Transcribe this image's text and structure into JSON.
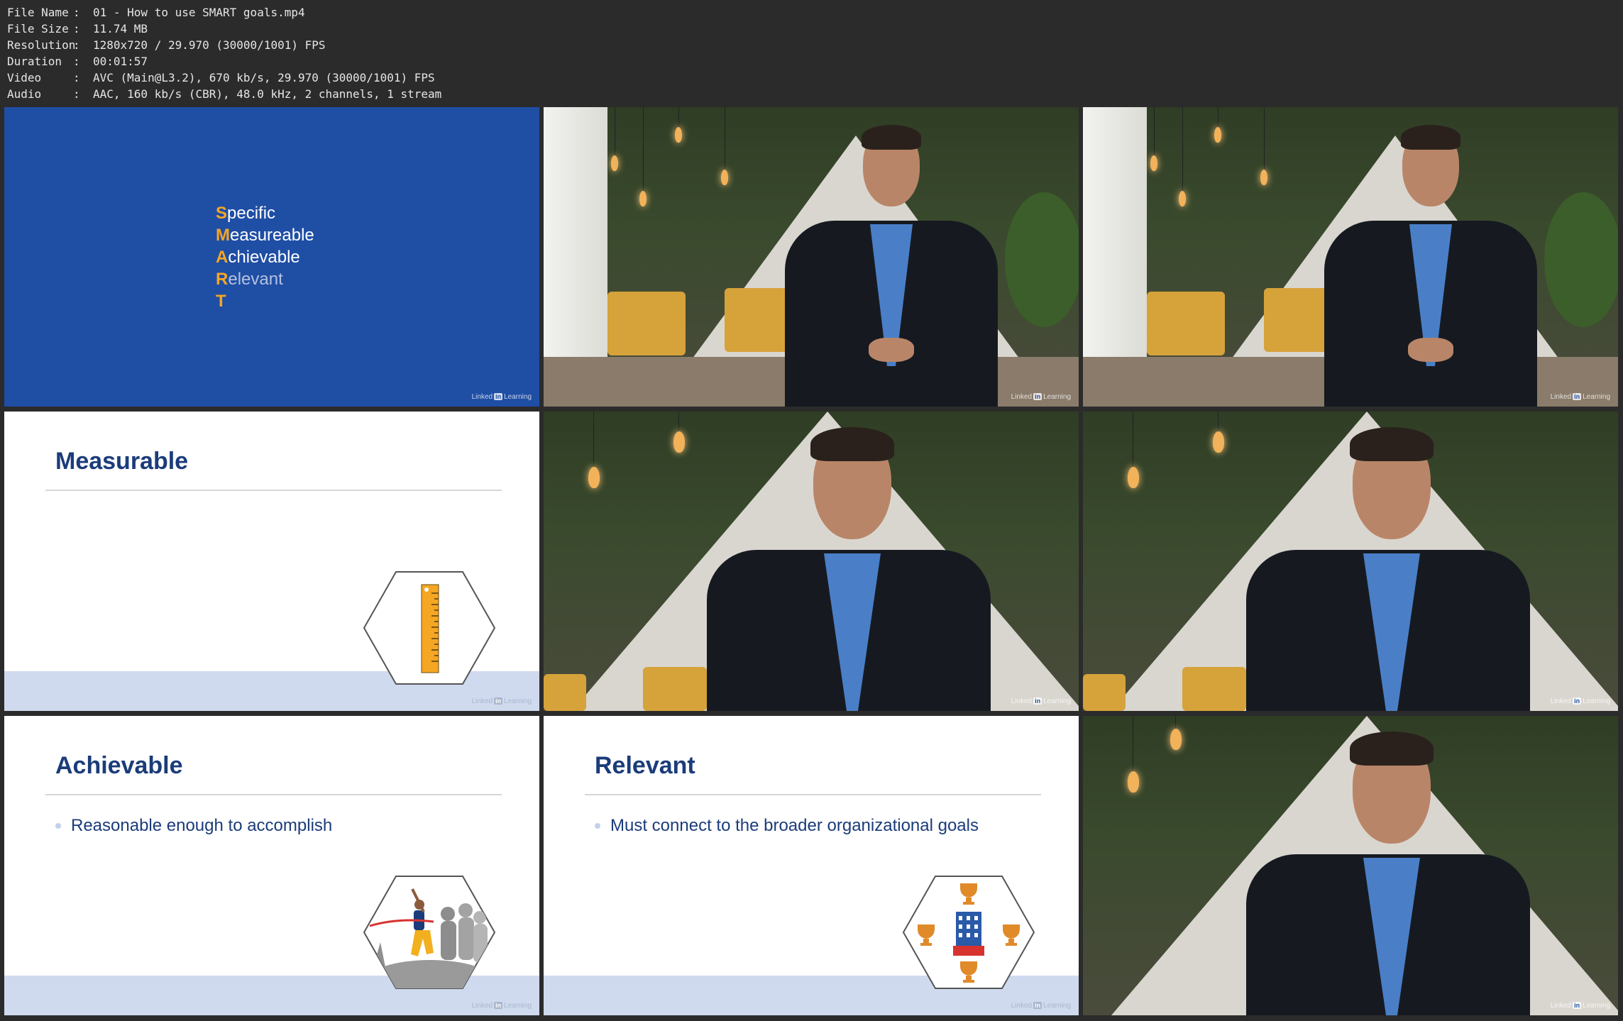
{
  "meta": [
    {
      "key": "File Name",
      "value": "01 - How to use SMART goals.mp4"
    },
    {
      "key": "File Size",
      "value": "11.74 MB"
    },
    {
      "key": "Resolution",
      "value": "1280x720 / 29.970 (30000/1001) FPS"
    },
    {
      "key": "Duration",
      "value": "00:01:57"
    },
    {
      "key": "Video",
      "value": "AVC (Main@L3.2), 670 kb/s, 29.970 (30000/1001) FPS"
    },
    {
      "key": "Audio",
      "value": "AAC, 160 kb/s (CBR), 48.0 kHz, 2 channels, 1 stream"
    }
  ],
  "separator": ":",
  "watermark": {
    "pre": "Linked",
    "in": "in",
    "post": "Learning"
  },
  "smart": [
    {
      "letter": "S",
      "rest": "pecific"
    },
    {
      "letter": "M",
      "rest": "easureable"
    },
    {
      "letter": "A",
      "rest": "chievable"
    },
    {
      "letter": "R",
      "rest": "elevant"
    },
    {
      "letter": "T",
      "rest": ""
    }
  ],
  "slides": {
    "measurable": {
      "title": "Measurable"
    },
    "achievable": {
      "title": "Achievable",
      "bullet": "Reasonable enough to accomplish"
    },
    "relevant": {
      "title": "Relevant",
      "bullet": "Must connect to the broader organizational goals"
    }
  },
  "colors": {
    "slide_blue": "#1f4ea5",
    "accent_orange": "#f5a623",
    "title_navy": "#1b3c7a"
  }
}
